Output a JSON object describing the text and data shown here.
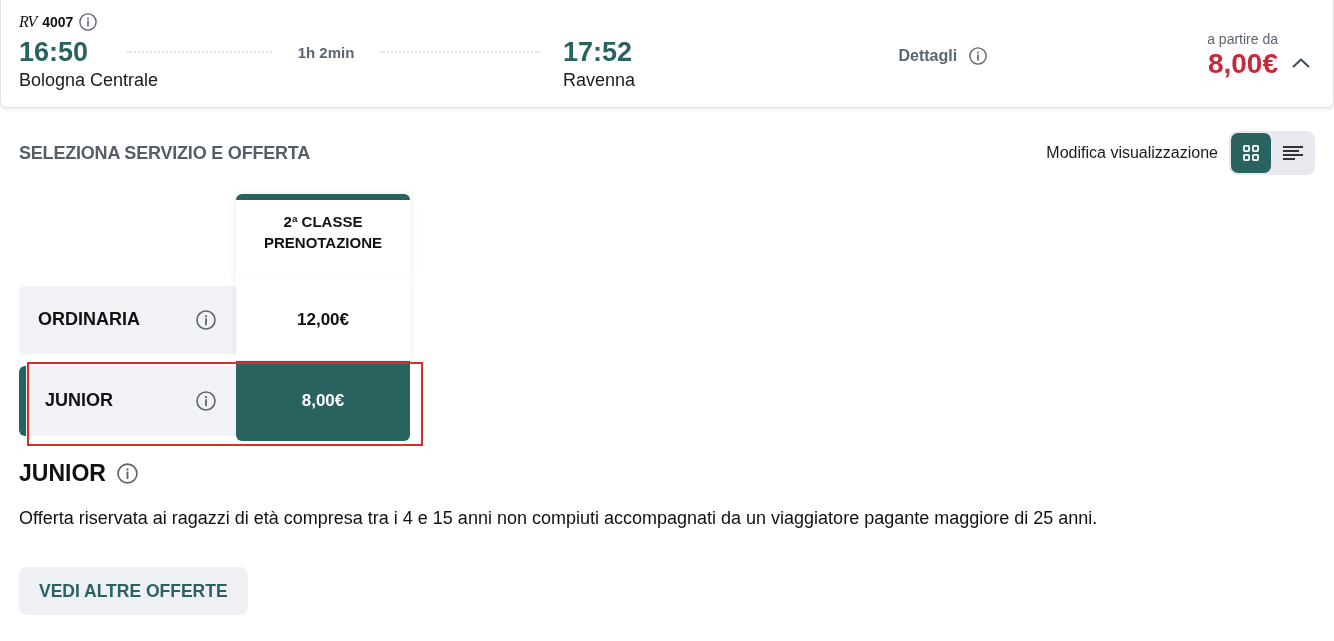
{
  "train": {
    "category": "RV",
    "number": "4007",
    "departure": {
      "time": "16:50",
      "station": "Bologna Centrale"
    },
    "duration": "1h 2min",
    "arrival": {
      "time": "17:52",
      "station": "Ravenna"
    },
    "details_label": "Dettagli",
    "price_caption": "a partire da",
    "price": "8,00€",
    "expanded": true
  },
  "section": {
    "title": "SELEZIONA SERVIZIO E OFFERTA",
    "view_label": "Modifica visualizzazione",
    "view_options": [
      {
        "kind": "grid",
        "selected": true
      },
      {
        "kind": "list",
        "selected": false
      }
    ]
  },
  "offers_table": {
    "columns": [
      "2ª CLASSE PRENOTAZIONE"
    ],
    "rows": [
      {
        "name": "ORDINARIA",
        "price": "12,00€",
        "selected": false,
        "highlighted": false
      },
      {
        "name": "JUNIOR",
        "price": "8,00€",
        "selected": true,
        "highlighted": true
      }
    ]
  },
  "offer_detail": {
    "title": "JUNIOR",
    "description": "Offerta riservata ai ragazzi di età compresa tra i 4 e 15 anni non compiuti accompagnati da un viaggiatore pagante maggiore di 25 anni."
  },
  "more_button": "VEDI ALTRE OFFERTE"
}
